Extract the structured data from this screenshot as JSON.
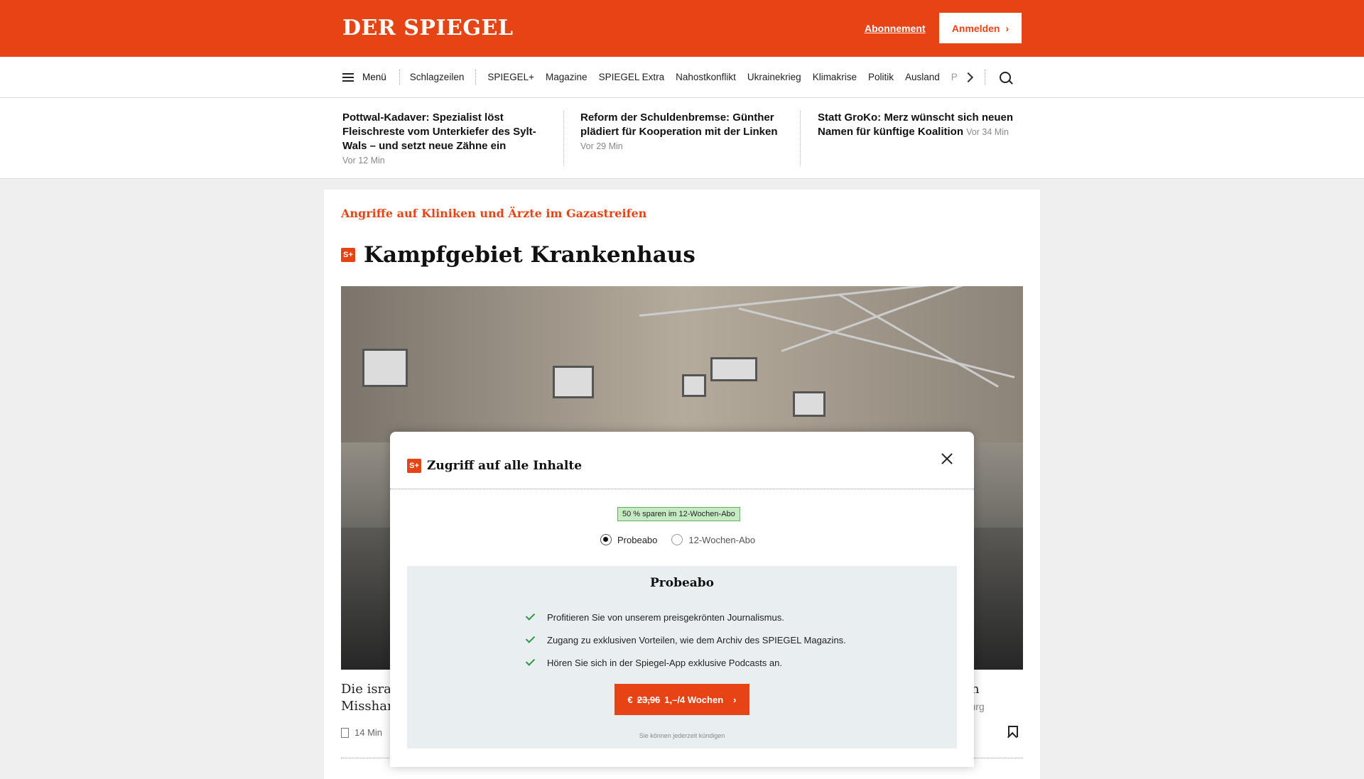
{
  "header": {
    "logo": "DER SPIEGEL",
    "subscription_link": "Abonnement",
    "login_button": "Anmelden",
    "brand_color": "#e64415"
  },
  "nav": {
    "menu_label": "Menü",
    "items": [
      "Schlagzeilen",
      "SPIEGEL+",
      "Magazine",
      "SPIEGEL Extra",
      "Nahostkonflikt",
      "Ukrainekrieg",
      "Klimakrise",
      "Politik",
      "Ausland",
      "Panorama"
    ]
  },
  "headlines": [
    {
      "title": "Pottwal-Kadaver: Spezialist löst Fleischreste vom Unterkiefer des Sylt-Wals – und setzt neue Zähne ein",
      "time": "Vor 12 Min"
    },
    {
      "title": "Reform der Schuldenbremse: Günther plädiert für Kooperation mit der Linken",
      "time": "Vor 29 Min"
    },
    {
      "title": "Statt GroKo: Merz wünscht sich neuen Namen für künftige Koalition",
      "time": "Vor 34 Min"
    }
  ],
  "article": {
    "kicker": "Angriffe auf Kliniken und Ärzte im Gazastreifen",
    "badge": "S+",
    "title": "Kampfgebiet Krankenhaus",
    "teaser_left": "Die israe",
    "teaser_left_2": "Misshand",
    "teaser_right": "von",
    "teaser_right_2": "mburg",
    "read_time": "14 Min"
  },
  "modal": {
    "title": "Zugriff auf alle Inhalte",
    "badge": "S+",
    "savings_badge": "50 % sparen im 12-Wochen-Abo",
    "options": [
      {
        "label": "Probeabo",
        "selected": true
      },
      {
        "label": "12-Wochen-Abo",
        "selected": false
      }
    ],
    "plan_name": "Probeabo",
    "benefits": [
      "Profitieren Sie von unserem preisgekrönten Journalismus.",
      "Zugang zu exklusiven Vorteilen, wie dem Archiv des SPIEGEL Magazins.",
      "Hören Sie sich in der Spiegel-App exklusive Podcasts an."
    ],
    "cta_currency": "€",
    "cta_old_price": "23,96",
    "cta_new_price": "1,–/4 Wochen",
    "cancel_note": "Sie können jederzeit kündigen"
  }
}
